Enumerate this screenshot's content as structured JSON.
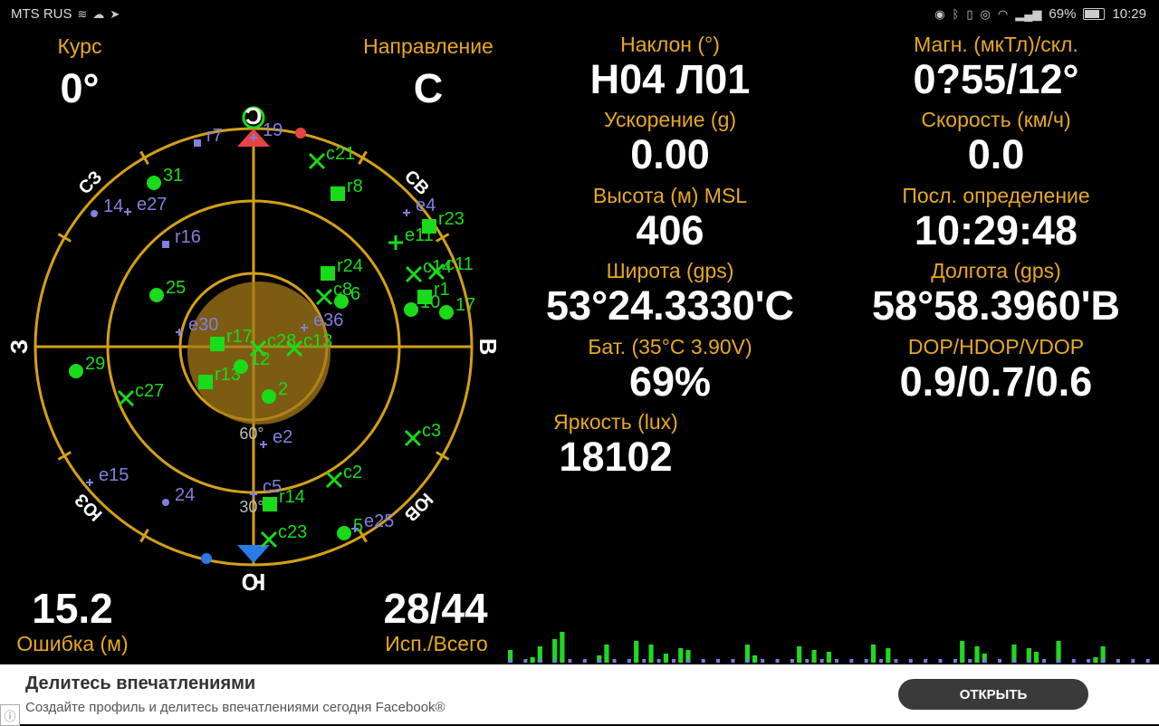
{
  "status_bar": {
    "carrier": "MTS RUS",
    "battery_percent": "69%",
    "time": "10:29",
    "icons_left": [
      "signal-icon",
      "cloud-icon",
      "telegram-icon"
    ],
    "icons_right": [
      "location-icon",
      "bluetooth-icon",
      "vibrate-icon",
      "eye-icon",
      "wifi-icon",
      "cellular-icon",
      "battery-icon"
    ]
  },
  "compass": {
    "course_label": "Курс",
    "course_value": "0°",
    "direction_label": "Направление",
    "direction_value": "С",
    "error_value": "15.2",
    "error_label": "Ошибка (м)",
    "sats_value": "28/44",
    "sats_label": "Исп./Всего",
    "cardinals": {
      "n": "С",
      "s": "Ю",
      "e": "В",
      "w": "З",
      "ne": "СВ",
      "nw": "СЗ",
      "se": "ЮВ",
      "sw": "ЮЗ"
    },
    "ring_labels": {
      "r30": "30°",
      "r60": "60°"
    }
  },
  "stats": {
    "tilt_label": "Наклон (°)",
    "tilt_value": "Н04 Л01",
    "mag_label": "Магн. (мкТл)/скл.",
    "mag_value": "0?55/12°",
    "accel_label": "Ускорение (g)",
    "accel_value": "0.00",
    "speed_label": "Скорость (км/ч)",
    "speed_value": "0.0",
    "altitude_label": "Высота (м) MSL",
    "altitude_value": "406",
    "lastfix_label": "Посл. определение",
    "lastfix_value": "10:29:48",
    "lat_label": "Широта (gps)",
    "lat_value": "53°24.3330'С",
    "lon_label": "Долгота (gps)",
    "lon_value": "58°58.3960'В",
    "bat_label": "Бат. (35°C 3.90V)",
    "bat_value": "69%",
    "dop_label": "DOP/HDOP/VDOP",
    "dop_value": "0.9/0.7/0.6",
    "lux_label": "Яркость (lux)",
    "lux_value": "18102"
  },
  "satellites": [
    {
      "id": "r7",
      "shape": "square-small",
      "color": "#8080e0"
    },
    {
      "id": "19",
      "shape": "cross-small",
      "color": "#8080e0"
    },
    {
      "id": "c21",
      "shape": "x",
      "color": "#1adb1a"
    },
    {
      "id": "31",
      "shape": "circle",
      "color": "#1adb1a"
    },
    {
      "id": "r8",
      "shape": "square",
      "color": "#1adb1a"
    },
    {
      "id": "14",
      "shape": "circle-small",
      "color": "#8080e0"
    },
    {
      "id": "e27",
      "shape": "cross-small",
      "color": "#8080e0"
    },
    {
      "id": "e4",
      "shape": "cross-small",
      "color": "#8080e0"
    },
    {
      "id": "r23",
      "shape": "square",
      "color": "#1adb1a"
    },
    {
      "id": "r16",
      "shape": "square-small",
      "color": "#8080e0"
    },
    {
      "id": "e11",
      "shape": "plus",
      "color": "#1adb1a"
    },
    {
      "id": "r24",
      "shape": "square",
      "color": "#1adb1a"
    },
    {
      "id": "c14",
      "shape": "x",
      "color": "#1adb1a"
    },
    {
      "id": "c11",
      "shape": "x",
      "color": "#1adb1a"
    },
    {
      "id": "25",
      "shape": "circle",
      "color": "#1adb1a"
    },
    {
      "id": "c8",
      "shape": "x",
      "color": "#1adb1a"
    },
    {
      "id": "6",
      "shape": "circle",
      "color": "#1adb1a"
    },
    {
      "id": "r1",
      "shape": "square",
      "color": "#1adb1a"
    },
    {
      "id": "10",
      "shape": "circle",
      "color": "#1adb1a"
    },
    {
      "id": "17",
      "shape": "circle",
      "color": "#1adb1a"
    },
    {
      "id": "e30",
      "shape": "cross-small",
      "color": "#8080e0"
    },
    {
      "id": "e36",
      "shape": "cross-small",
      "color": "#8080e0"
    },
    {
      "id": "r17",
      "shape": "square",
      "color": "#1adb1a"
    },
    {
      "id": "c28",
      "shape": "x",
      "color": "#1adb1a"
    },
    {
      "id": "c13",
      "shape": "x",
      "color": "#1adb1a"
    },
    {
      "id": "12",
      "shape": "circle",
      "color": "#1adb1a"
    },
    {
      "id": "29",
      "shape": "circle",
      "color": "#1adb1a"
    },
    {
      "id": "r13",
      "shape": "square",
      "color": "#1adb1a"
    },
    {
      "id": "2",
      "shape": "circle",
      "color": "#1adb1a"
    },
    {
      "id": "c27",
      "shape": "x",
      "color": "#1adb1a"
    },
    {
      "id": "c3",
      "shape": "x",
      "color": "#1adb1a"
    },
    {
      "id": "e2",
      "shape": "cross-small",
      "color": "#8080e0"
    },
    {
      "id": "e15",
      "shape": "cross-small",
      "color": "#8080e0"
    },
    {
      "id": "c2",
      "shape": "x",
      "color": "#1adb1a"
    },
    {
      "id": "24",
      "shape": "circle-small",
      "color": "#8080e0"
    },
    {
      "id": "c5",
      "shape": "cross-small",
      "color": "#8080e0"
    },
    {
      "id": "r14",
      "shape": "square",
      "color": "#1adb1a"
    },
    {
      "id": "c23",
      "shape": "x",
      "color": "#1adb1a"
    },
    {
      "id": "5",
      "shape": "circle",
      "color": "#1adb1a"
    },
    {
      "id": "e25",
      "shape": "cross-small",
      "color": "#8080e0"
    }
  ],
  "ad": {
    "title": "Делитесь впечатлениями",
    "subtitle": "Создайте профиль и делитесь впечатлениями сегодня Facebook®",
    "button": "ОТКРЫТЬ",
    "info_icon": "ⓘ"
  }
}
